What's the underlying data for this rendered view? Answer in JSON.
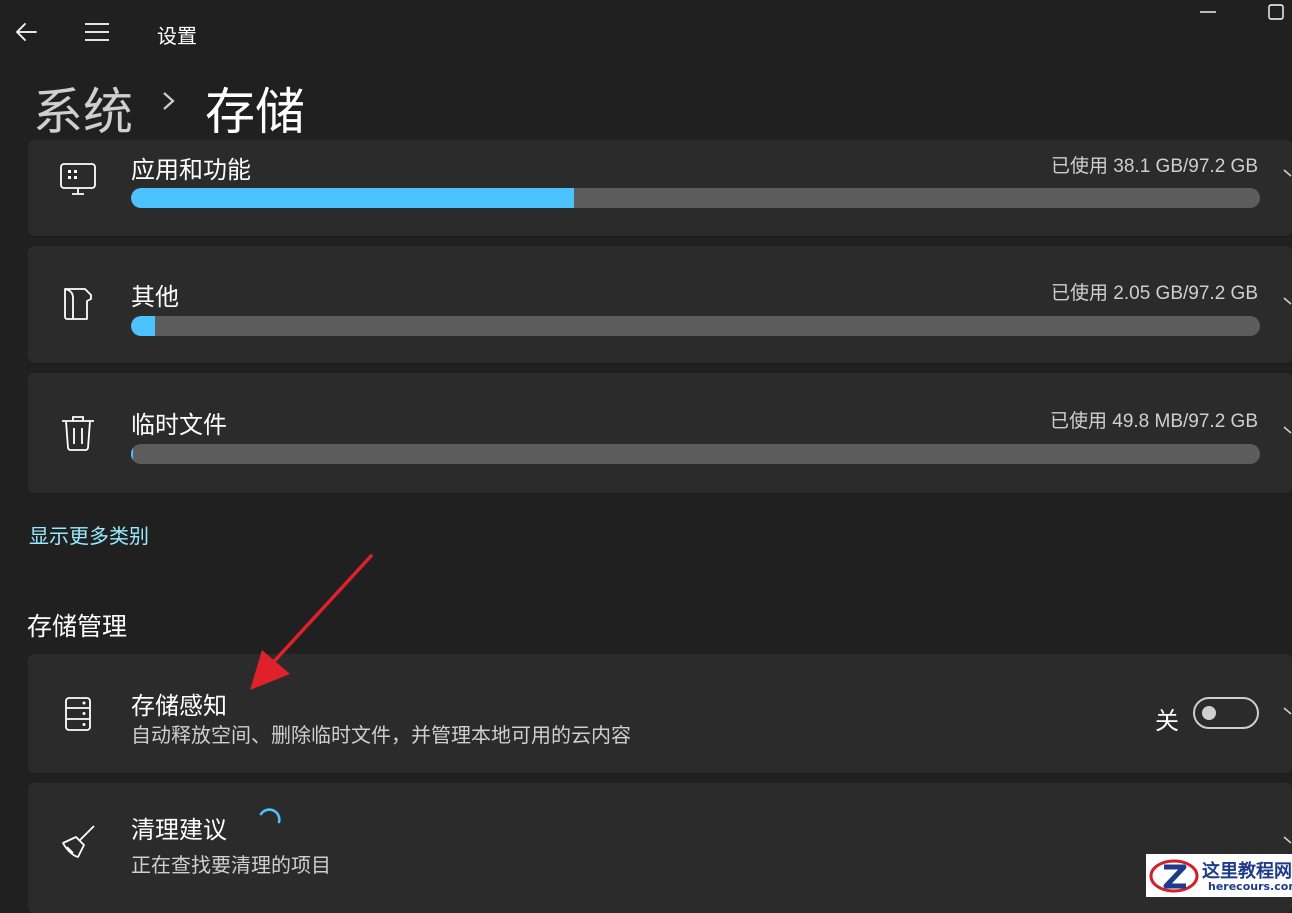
{
  "titlebar": {
    "title": "设置"
  },
  "breadcrumb": {
    "parent": "系统",
    "separator": "›",
    "current": "存储"
  },
  "categories": [
    {
      "title": "应用和功能",
      "usage": "已使用 38.1 GB/97.2 GB",
      "fraction": 0.392,
      "icon": "apps-icon"
    },
    {
      "title": "其他",
      "usage": "已使用 2.05 GB/97.2 GB",
      "fraction": 0.021,
      "icon": "document-icon"
    },
    {
      "title": "临时文件",
      "usage": "已使用 49.8 MB/97.2 GB",
      "fraction": 0.0005,
      "icon": "trash-icon"
    }
  ],
  "show_more": "显示更多类别",
  "management": {
    "heading": "存储管理",
    "storage_sense": {
      "title": "存储感知",
      "subtitle": "自动释放空间、删除临时文件，并管理本地可用的云内容",
      "toggle_label": "关",
      "toggle_on": false
    },
    "cleanup": {
      "title": "清理建议",
      "subtitle": "正在查找要清理的项目"
    }
  },
  "watermark": {
    "name": "这里教程网",
    "url": "herecours.com"
  },
  "colors": {
    "accent": "#4cc2ff",
    "link": "#99ebff",
    "annotation_arrow": "#e0212b"
  }
}
